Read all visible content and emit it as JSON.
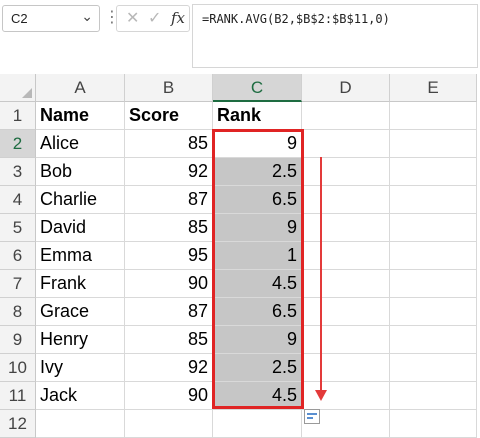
{
  "formula_bar": {
    "cell_ref": "C2",
    "name_box_arrow": "chevron-down-icon",
    "dots": "⋮",
    "cancel_glyph": "✕",
    "confirm_glyph": "✓",
    "fx_label": "fx",
    "formula": "=RANK.AVG(B2,$B$2:$B$11,0)"
  },
  "columns": [
    "A",
    "B",
    "C",
    "D",
    "E"
  ],
  "active_column": "C",
  "rows": [
    "1",
    "2",
    "3",
    "4",
    "5",
    "6",
    "7",
    "8",
    "9",
    "10",
    "11",
    "12"
  ],
  "active_row": "2",
  "headers": {
    "name": "Name",
    "score": "Score",
    "rank": "Rank"
  },
  "data": [
    {
      "name": "Alice",
      "score": "85",
      "rank": "9"
    },
    {
      "name": "Bob",
      "score": "92",
      "rank": "2.5"
    },
    {
      "name": "Charlie",
      "score": "87",
      "rank": "6.5"
    },
    {
      "name": "David",
      "score": "85",
      "rank": "9"
    },
    {
      "name": "Emma",
      "score": "95",
      "rank": "1"
    },
    {
      "name": "Frank",
      "score": "90",
      "rank": "4.5"
    },
    {
      "name": "Grace",
      "score": "87",
      "rank": "6.5"
    },
    {
      "name": "Henry",
      "score": "85",
      "rank": "9"
    },
    {
      "name": "Ivy",
      "score": "92",
      "rank": "2.5"
    },
    {
      "name": "Jack",
      "score": "90",
      "rank": "4.5"
    }
  ],
  "colors": {
    "accent_green": "#1e6c41",
    "annotation_red": "#e02424",
    "selection_fill": "#c6c6c6"
  }
}
